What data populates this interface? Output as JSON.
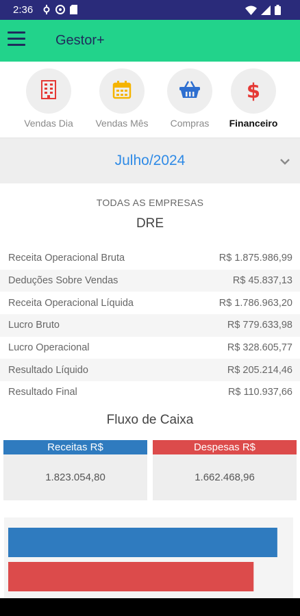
{
  "status_bar": {
    "time": "2:36",
    "left_icons": [
      "settings-icon",
      "sync-icon",
      "sim-icon"
    ],
    "right_icons": [
      "wifi-icon",
      "signal-icon",
      "battery-icon"
    ]
  },
  "app_bar": {
    "title": "Gestor+",
    "bg_color": "#22d38b",
    "menu_icon": "hamburger-menu-icon"
  },
  "tabs": [
    {
      "label": "Vendas Dia",
      "icon": "building-icon",
      "active": false
    },
    {
      "label": "Vendas Mês",
      "icon": "calendar-icon",
      "active": false
    },
    {
      "label": "Compras",
      "icon": "basket-icon",
      "active": false
    },
    {
      "label": "Financeiro",
      "icon": "dollar-icon",
      "active": true
    }
  ],
  "period": {
    "label": "Julho/2024",
    "chevron": "chevron-down-icon"
  },
  "company_scope": "TODAS AS EMPRESAS",
  "dre": {
    "title": "DRE",
    "rows": [
      {
        "label": "Receita Operacional Bruta",
        "value": "R$ 1.875.986,99"
      },
      {
        "label": "Deduções Sobre Vendas",
        "value": "R$ 45.837,13"
      },
      {
        "label": "Receita Operacional Líquida",
        "value": "R$ 1.786.963,20"
      },
      {
        "label": "Lucro Bruto",
        "value": "R$ 779.633,98"
      },
      {
        "label": "Lucro Operacional",
        "value": "R$ 328.605,77"
      },
      {
        "label": "Resultado Líquido",
        "value": "R$ 205.214,46"
      },
      {
        "label": "Resultado Final",
        "value": "R$ 110.937,66"
      }
    ]
  },
  "fluxo": {
    "title": "Fluxo de Caixa",
    "receitas": {
      "label": "Receitas R$",
      "value": "1.823.054,80",
      "color": "#2f7bbf"
    },
    "despesas": {
      "label": "Despesas R$",
      "value": "1.662.468,96",
      "color": "#dc4b4b"
    }
  },
  "chart_data": {
    "type": "bar",
    "orientation": "horizontal",
    "categories": [
      "Receitas",
      "Despesas"
    ],
    "values": [
      1823054.8,
      1662468.96
    ],
    "colors": [
      "#2f7bbf",
      "#dc4b4b"
    ],
    "xlim": [
      0,
      1870000
    ],
    "grid": false
  }
}
